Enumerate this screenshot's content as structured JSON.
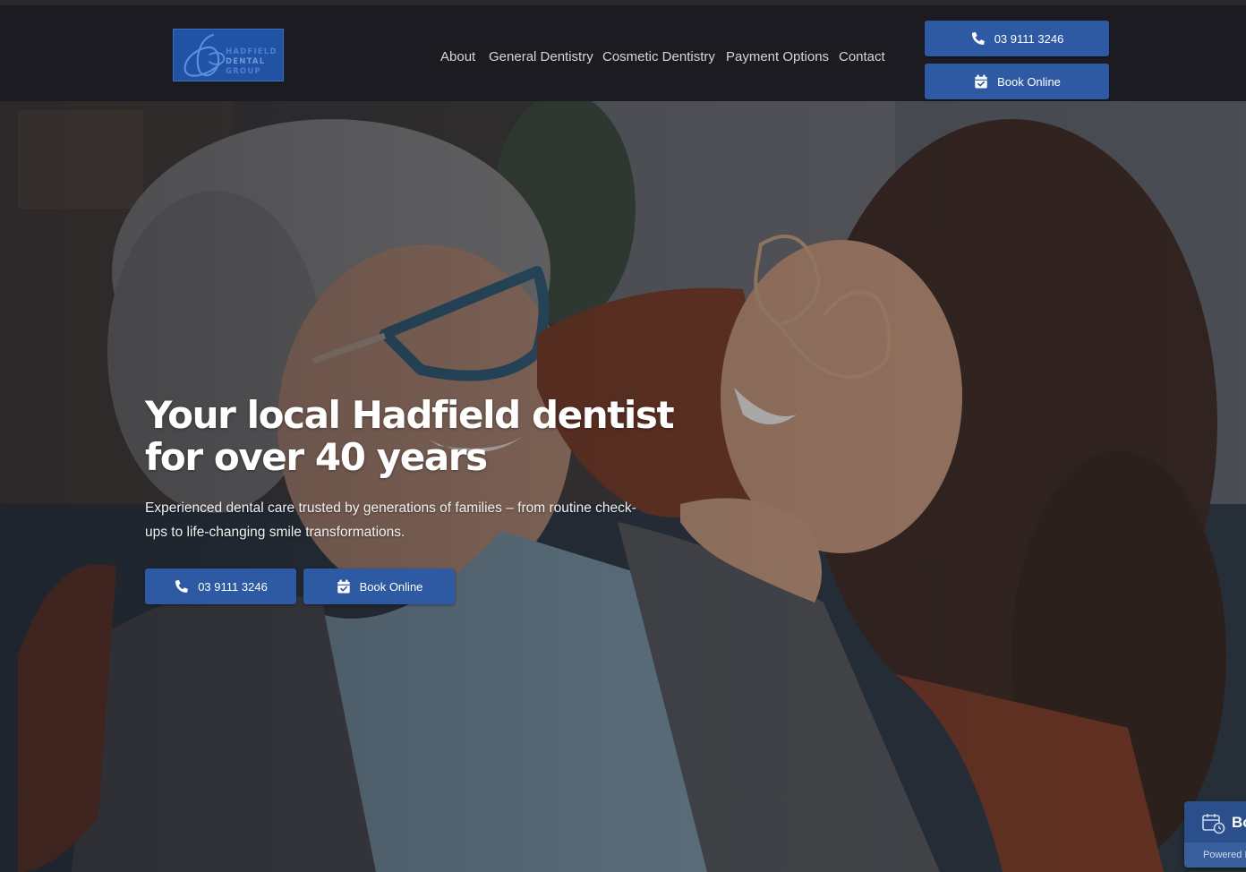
{
  "brand": {
    "logo_lines": [
      "HADFIELD",
      "DENTAL",
      "GROUP"
    ],
    "accent": "#2d5aa2",
    "header_bg": "#1c1b22"
  },
  "nav": {
    "items": [
      "About",
      "General Dentistry",
      "Cosmetic Dentistry",
      "Payment Options",
      "Contact"
    ]
  },
  "header_actions": {
    "phone_label": "03 9111 3246",
    "phone_icon": "phone-icon",
    "book_label": "Book Online",
    "book_icon": "calendar-check-icon"
  },
  "hero": {
    "title_line1": "Your local Hadfield dentist",
    "title_line2": "for over 40 years",
    "subtitle": "Experienced dental care trusted by generations of families – from routine check-ups to life-changing smile transformations.",
    "cta_phone_label": "03 9111 3246",
    "cta_book_label": "Book Online"
  },
  "widget": {
    "label": "Bo",
    "powered": "Powered B",
    "icon": "calendar-clock-icon"
  }
}
